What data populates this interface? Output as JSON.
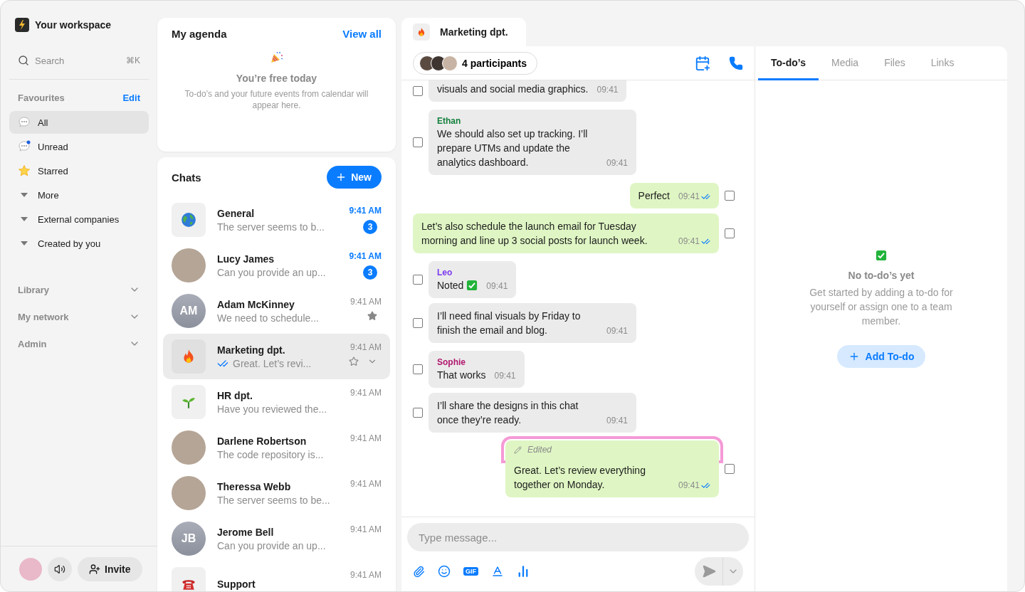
{
  "sidebar": {
    "workspace": "Your workspace",
    "search": {
      "placeholder": "Search",
      "shortcut": "⌘K"
    },
    "favourites": {
      "title": "Favourites",
      "action": "Edit",
      "items": [
        {
          "label": "All",
          "kind": "chat",
          "selected": true
        },
        {
          "label": "Unread",
          "kind": "unread",
          "selected": false
        },
        {
          "label": "Starred",
          "kind": "star",
          "selected": false
        },
        {
          "label": "More",
          "kind": "group",
          "selected": false
        },
        {
          "label": "External companies",
          "kind": "group",
          "selected": false
        },
        {
          "label": "Created by you",
          "kind": "group",
          "selected": false
        }
      ]
    },
    "sections": [
      {
        "label": "Library"
      },
      {
        "label": "My network"
      },
      {
        "label": "Admin"
      }
    ],
    "invite": "Invite"
  },
  "agenda": {
    "title": "My agenda",
    "link": "View all",
    "empty_title": "You’re free today",
    "empty_text": "To-do’s and your future events from calendar will appear here."
  },
  "chats": {
    "title": "Chats",
    "new_button": "New",
    "items": [
      {
        "name": "General",
        "preview": "The server seems to b...",
        "time": "9:41 AM",
        "kind": "group",
        "unread": true,
        "badge": "3",
        "starred": false,
        "receipt": false,
        "selected": false
      },
      {
        "name": "Lucy James",
        "preview": "Can you provide an up...",
        "time": "9:41 AM",
        "kind": "person",
        "unread": true,
        "badge": "3",
        "starred": false,
        "receipt": false,
        "selected": false
      },
      {
        "name": "Adam McKinney",
        "preview": "We need to schedule...",
        "time": "9:41 AM",
        "kind": "contact",
        "initials": "AM",
        "unread": false,
        "starred": true,
        "receipt": false,
        "selected": false
      },
      {
        "name": "Marketing dpt.",
        "preview": "Great. Let’s revi...",
        "time": "9:41 AM",
        "kind": "group",
        "unread": false,
        "starred": false,
        "receipt": true,
        "selected": true
      },
      {
        "name": "HR dpt.",
        "preview": "Have you reviewed the...",
        "time": "9:41 AM",
        "kind": "group",
        "unread": false,
        "starred": false,
        "receipt": false,
        "selected": false
      },
      {
        "name": "Darlene Robertson",
        "preview": "The code repository is...",
        "time": "9:41 AM",
        "kind": "person",
        "unread": false,
        "starred": false,
        "receipt": false,
        "selected": false
      },
      {
        "name": "Theressa Webb",
        "preview": "The server seems to be...",
        "time": "9:41 AM",
        "kind": "person",
        "unread": false,
        "starred": false,
        "receipt": false,
        "selected": false
      },
      {
        "name": "Jerome Bell",
        "preview": "Can you provide an up...",
        "time": "9:41 AM",
        "kind": "contact",
        "initials": "JB",
        "unread": false,
        "starred": false,
        "receipt": false,
        "selected": false
      },
      {
        "name": "Support",
        "time": "9:41 AM",
        "kind": "group",
        "unread": false,
        "starred": false,
        "receipt": false,
        "selected": false
      }
    ]
  },
  "conversation": {
    "tab": {
      "title": "Marketing dpt."
    },
    "participants": "4 participants",
    "messages": [
      {
        "kind": "in",
        "text": "visuals and social media graphics.",
        "time": "09:41",
        "checked": false
      },
      {
        "kind": "in",
        "sender": "Ethan",
        "color": "#15803d",
        "text": "We should also set up tracking. I’ll prepare UTMs and update the analytics dashboard.",
        "time": "09:41",
        "checked": false
      },
      {
        "kind": "out",
        "text": "Perfect",
        "time": "09:41",
        "read": true,
        "checked": false
      },
      {
        "kind": "out",
        "text": "Let’s also schedule the launch email for Tuesday morning and line up 3 social posts for launch week.",
        "time": "09:41",
        "read": true,
        "checked": false
      },
      {
        "kind": "in",
        "sender": "Leo",
        "color": "#7c3aed",
        "text": "Noted",
        "time": "09:41",
        "checked": false
      },
      {
        "kind": "in",
        "text": "I’ll need final visuals by Friday to finish the email and blog.",
        "time": "09:41",
        "checked": false
      },
      {
        "kind": "in",
        "sender": "Sophie",
        "color": "#b0186e",
        "text": "That works",
        "time": "09:41",
        "checked": false
      },
      {
        "kind": "in",
        "text": "I’ll share the designs in this chat once they’re ready.",
        "time": "09:41",
        "checked": false
      },
      {
        "kind": "out",
        "edited": "Edited",
        "highlighted": true,
        "text": "Great. Let’s review everything together on Monday.",
        "time": "09:41",
        "read": true,
        "checked": false
      }
    ],
    "composer": {
      "placeholder": "Type message...",
      "gif": "GIF"
    }
  },
  "details": {
    "tabs": [
      {
        "label": "To-do’s",
        "selected": true
      },
      {
        "label": "Media",
        "selected": false
      },
      {
        "label": "Files",
        "selected": false
      },
      {
        "label": "Links",
        "selected": false
      }
    ],
    "empty_title": "No to-do’s yet",
    "empty_text": "Get started by adding a to-do for yourself or assign one to a team member.",
    "button": "Add To-do"
  }
}
